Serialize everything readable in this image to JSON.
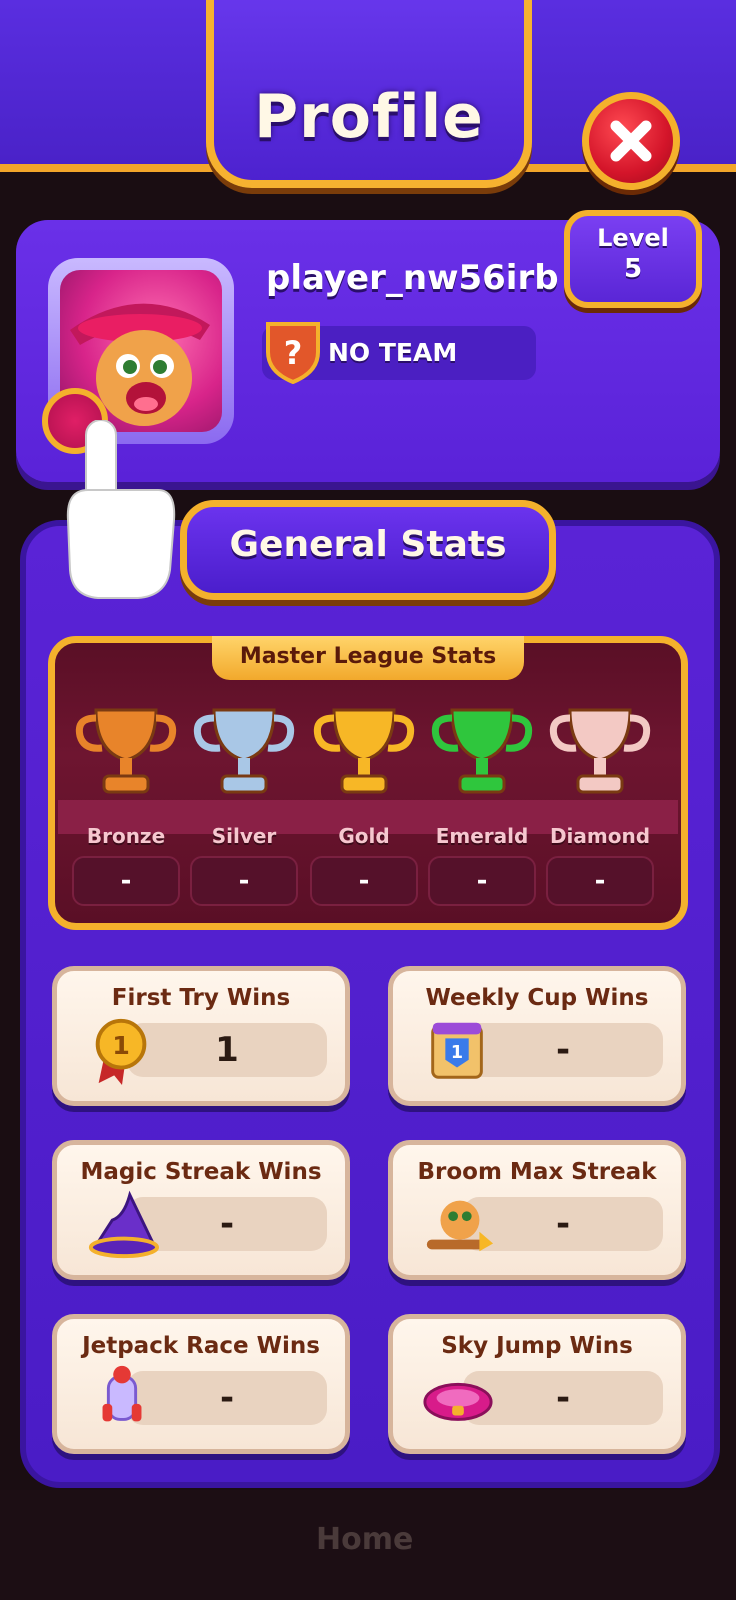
{
  "header": {
    "title": "Profile"
  },
  "profile": {
    "username": "player_nw56irb",
    "team": "NO TEAM",
    "level_label": "Level",
    "level_value": "5"
  },
  "stats": {
    "section_title": "General Stats",
    "league": {
      "title": "Master League Stats",
      "tiers": [
        {
          "name": "Bronze",
          "value": "-",
          "color": "#e8842a"
        },
        {
          "name": "Silver",
          "value": "-",
          "color": "#a9c7e6"
        },
        {
          "name": "Gold",
          "value": "-",
          "color": "#f7b726"
        },
        {
          "name": "Emerald",
          "value": "-",
          "color": "#2fc63d"
        },
        {
          "name": "Diamond",
          "value": "-",
          "color": "#f3c9c4"
        }
      ]
    },
    "cards": [
      {
        "title": "First Try Wins",
        "value": "1",
        "icon": "medal-icon"
      },
      {
        "title": "Weekly Cup Wins",
        "value": "-",
        "icon": "cup-icon"
      },
      {
        "title": "Magic Streak Wins",
        "value": "-",
        "icon": "wizard-hat-icon"
      },
      {
        "title": "Broom Max Streak",
        "value": "-",
        "icon": "cat-broom-icon"
      },
      {
        "title": "Jetpack Race Wins",
        "value": "-",
        "icon": "jetpack-icon"
      },
      {
        "title": "Sky Jump Wins",
        "value": "-",
        "icon": "trampoline-icon"
      }
    ]
  },
  "nav": {
    "home_label": "Home"
  },
  "colors": {
    "accent_gold": "#f4b12c",
    "panel_purple": "#5a23d6",
    "close_red": "#d4152a"
  }
}
